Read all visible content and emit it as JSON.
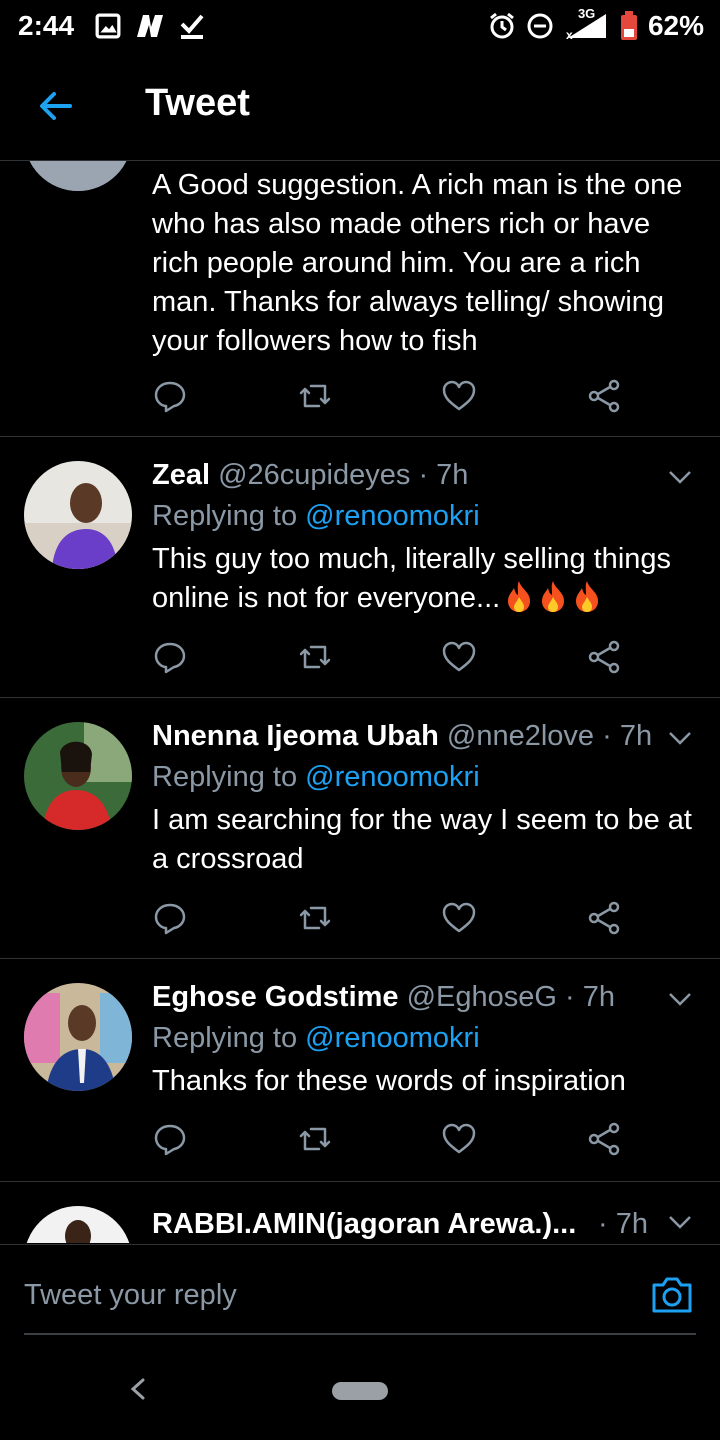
{
  "status_bar": {
    "time": "2:44",
    "network": "3G",
    "battery": "62%",
    "left_icons": [
      "image-icon",
      "news-icon",
      "download-done-icon"
    ],
    "right_icons": [
      "alarm-icon",
      "do-not-disturb-icon",
      "signal-icon",
      "battery-icon"
    ]
  },
  "header": {
    "title": "Tweet",
    "back_icon": "arrow-left-icon"
  },
  "tweets": [
    {
      "text": "A Good suggestion. A rich man is the one who has also made others rich or have rich people around him. You are a rich man. Thanks for always telling/ showing your followers how to fish"
    },
    {
      "name": "Zeal",
      "handle": "@26cupideyes",
      "time": "· 7h",
      "reply_prefix": "Replying to",
      "reply_handle": "@renoomokri",
      "text": "This guy too much, literally selling things online is not for everyone...",
      "emoji": [
        "fire",
        "fire",
        "fire"
      ]
    },
    {
      "name": "Nnenna Ijeoma Ubah",
      "handle": "@nne2love",
      "time": "· 7h",
      "reply_prefix": "Replying to",
      "reply_handle": "@renoomokri",
      "text": "I am searching for the way I seem to be at a crossroad"
    },
    {
      "name": "Eghose Godstime",
      "handle": "@EghoseG",
      "time": "· 7h",
      "reply_prefix": "Replying to",
      "reply_handle": "@renoomokri",
      "text": "Thanks for these words of inspiration"
    },
    {
      "name": "RABBI.AMIN(jagoran Arewa.)...",
      "time": "· 7h"
    }
  ],
  "compose": {
    "placeholder": "Tweet your reply",
    "camera_icon": "camera-icon"
  },
  "colors": {
    "accent": "#1da1f2",
    "background": "#000000",
    "muted": "#8b98a5",
    "divider": "#2f3336",
    "like_red": "#e0245e"
  }
}
